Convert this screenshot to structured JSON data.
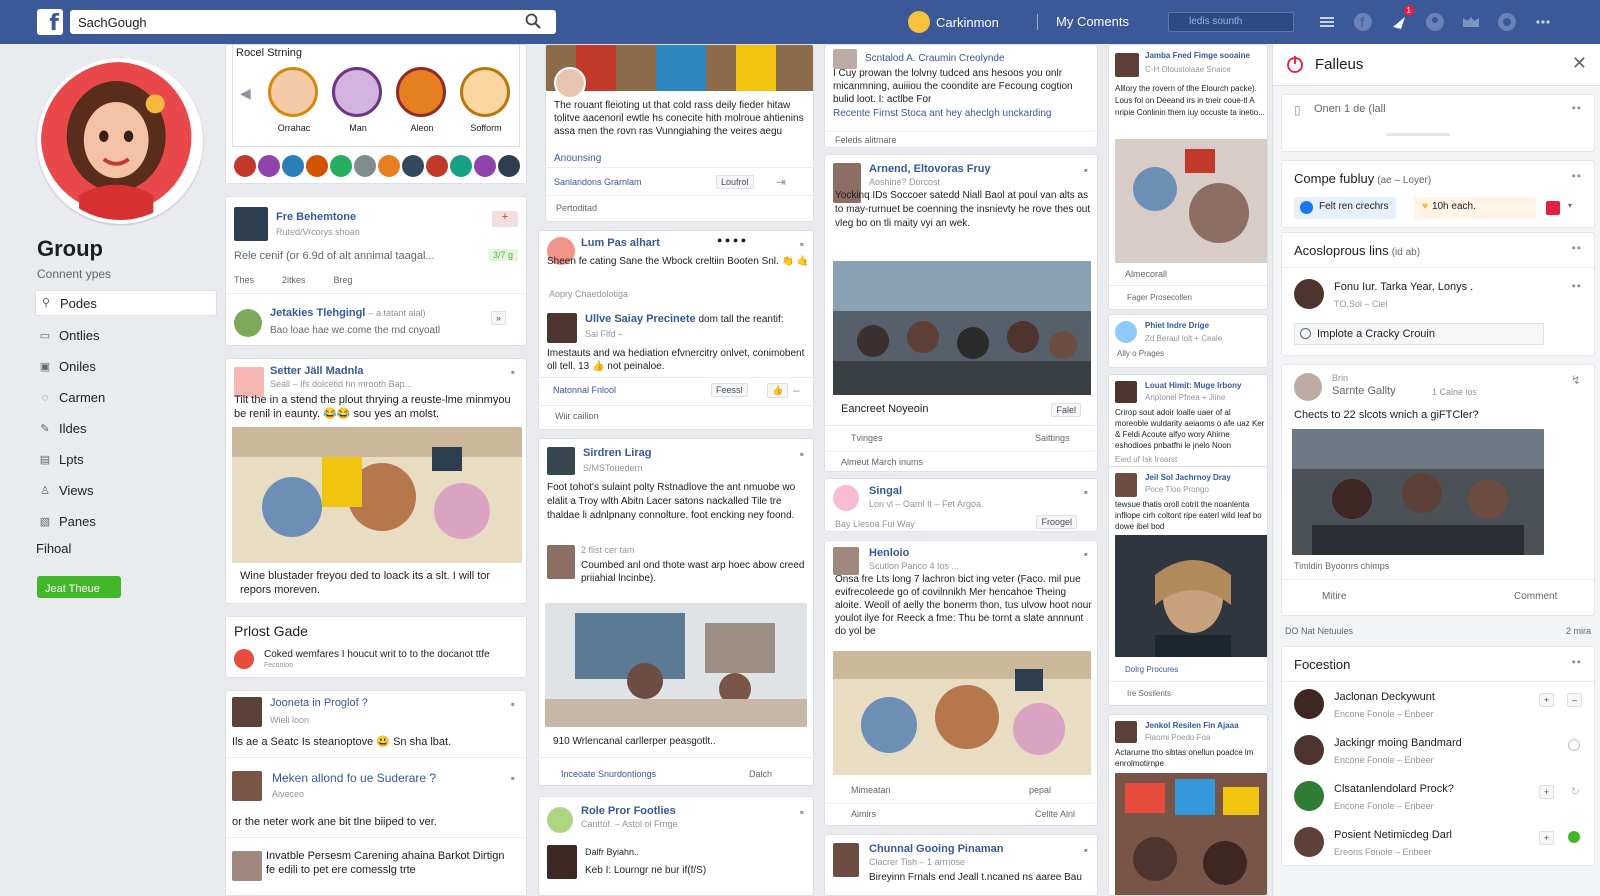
{
  "topbar": {
    "search_value": "SachGough",
    "user_name": "Carkinmon",
    "link": "My Coments",
    "selector": "ledis sounth",
    "notif_count": "1"
  },
  "left": {
    "group_title": "Group",
    "group_sub": "Connent ypes",
    "nav": [
      "Podes",
      "Ontlies",
      "Oniles",
      "Carmen",
      "Ildes",
      "Lpts",
      "Views",
      "Panes"
    ],
    "nav_final": "Fihoal",
    "button": "Jeat Theue"
  },
  "col1": {
    "reel_title": "Rocel Strning",
    "reel_names": [
      "Orrahac",
      "Man",
      "Aleon",
      "Sofform"
    ],
    "post1": {
      "name": "Fre Behemtone",
      "meta": "Ruted/Vrcorys shoan",
      "text": "Rele cenif (or 6.9d of alt annimal taagal...",
      "tag": "3/7 g",
      "actions": [
        "Thes",
        "2itkes",
        "Breg"
      ]
    },
    "post1_comment": {
      "name": "Jetakies Tlehgingl",
      "meta": "– a tatant alal)",
      "text": "Bao loae hae we come the rnd cnyoatl"
    },
    "post2": {
      "name": "Setter Jäll Madnla",
      "meta": "Seall – Ifs dolcetid hn mrooth Bap...",
      "text": "Tilt the in a stend the plout thrying a reuste-lme minmyou be renil in eaunty. 😂😂 sou yes an molst.",
      "caption": "Wine blustader freyou ded to loack its a slt. I will tor repors moreven."
    },
    "post3": {
      "title": "Prlost Gade",
      "text": "Coked wemfares I houcut writ to to the docanot ttfe",
      "meta": "Fecontoo"
    },
    "post4": {
      "name": "Jooneta in Proglof ?",
      "meta": "Wieli loon",
      "text": "Ils ae a Seatc Is steanoptove 😃 Sn sha lbat."
    },
    "post5": {
      "name": "Meken allond fo ue Suderare ?",
      "meta": "Aiveceo",
      "text": "or the neter work ane bit tlne biiped to ver."
    },
    "post6": {
      "text": "Invatble Persesm Carening ahaina Barkot Dirtign fe edili to pet ere comesslg trte"
    }
  },
  "col2": {
    "post1": {
      "text": "The rouant fleioting ut that cold rass deily fieder hitaw tolitve aacenoril ewtle hs conecite hith molroue ahtienins assa men the rovn ras Vunngiahing the veires aegu",
      "link": "Anounsing",
      "name": "Sanlandons Grarnlam",
      "btn": "Loufrol",
      "footer": "Pertoditad"
    },
    "post2": {
      "name": "Lum Pas alhart",
      "text": "Sheen fe cating Sane the Wbock creltiin Booten Snl. 👏 🤙",
      "meta": "Aopry Chaedolotiga"
    },
    "post2_sub": {
      "name": "Ullve Saiay Precinete",
      "meta": "Sal Flfd –",
      "tail": "dom tall the reantif:",
      "text": "Imestauts and wa hediation efvnercitry onlvet, conimobent oll tell. 13 👍 not peinaloe.",
      "link": "Natonnal Fnlool",
      "btn": "Feessl",
      "footer": "Wiir cailion"
    },
    "post3": {
      "name": "Sirdren Lirag",
      "meta": "S/MSTouedern",
      "text": "Foot tohot's sulaint polty Rstnadlove the ant nmuobe wo elalit a Troy wlth Abitn Lacer satons nackalled Tile tre thaldae li adnlpnany connolture. foot encking ney foond.",
      "sub_meta": "2 flist cer tam",
      "sub_text": "Coumbed anl ond thote wast arp hoec abow creed priiahial lncinbe).",
      "caption": "910 Wrlencanal carllerper peasgotlt..",
      "footer_link": "Inceoate Snurdontiongs",
      "footer_btn": "Dalch"
    },
    "post4": {
      "name": "Role Pror Footlies",
      "meta": "Canttof. – Astol ol Frnge",
      "sub": "Dalfr Byiahn..",
      "sub2": "Keb I: Lourngr ne bur if(f/S)"
    }
  },
  "col3": {
    "post1": {
      "name": "Scntalod A. Craumin Creolynde",
      "text": "I Cuy prowan the lolvny tudced ans hesoos you onlr micanmning, auiiiou the coondite are Fecoung cogtion bulid loot. I: actlbe For",
      "link": "Recente Firnst Stoca ant hey aheclgh unckarding",
      "footer": "Feleds alitmare"
    },
    "post2": {
      "name": "Arnend, Eltovoras Fruy",
      "meta": "Aoshine? Dorcost",
      "text": "Yockinq IDs Soccoer satedd Niall Baol at poul van alts as to may-rurnuet be coenning the insnievty he rove thes out vleg bo on tli maity vyi an wek.",
      "caption": "Eancreet Noyeoin",
      "btn": "Falel",
      "actions": [
        "Tvinges",
        "Saittings"
      ],
      "footer": "Almeut March inums"
    },
    "post3": {
      "name": "Singal",
      "meta": "Lon vl – Oaml It – Fet Argoa",
      "text": "Bay Llesoa Fui Way",
      "btn": "Froogel"
    },
    "post4": {
      "name": "Henloio",
      "meta": "Scutlon Panco 4 Ios ...",
      "text": "Onsa fre Lts long 7 lachron bict ing veter (Faco. mil pue evifrecoleede go of covilnnikh Mer hencahoe Theing aloite. Weoll of aelly the bonerm thon, tus ulvow hoot nour youlot ilye for Reeck a fme: Thu be tornt a slate annnunt do yol be",
      "footer": "Mimeatan",
      "btn": "pepal",
      "footer2": "Aimirs",
      "footer2_btn": "Cellte Alnl"
    },
    "post5": {
      "name": "Chunnal Gooing Pinaman",
      "meta": "Clacrer Tish – 1 arrnose",
      "text": "Bireyinn Frnals end Jeall t.ncaned ns aaree Bau"
    }
  },
  "col4": {
    "items": [
      {
        "name": "Jamba Fned Fimge sooaine",
        "meta": "C-H Oloustolaae Snaice",
        "text": "Alllory the rovern of tlhe Elourch packe). Lous fol on Deeand irs in tneir coue-tl A nripie Conlinin them iuy occuste ta inetio...",
        "footer": "Almecorall",
        "link": "Fager Prosecollen"
      },
      {
        "name": "Phiet Indre Drige",
        "meta": "Zd Beraul lolt + Ceale",
        "link": "Ally o Prages"
      },
      {
        "name": "Louat Himit: Muge Irbony",
        "meta": "Ariptonel Pfnea + Jiine",
        "text": "Crirop sout adoir loalle uaer of al moreoble wuldarity aeiaoms o afe uaz Ker & Feldi Acoute alfyo wory Ahirne eshodioes pnbatfhi le jnelo Noon",
        "meta2": "Eied uf Isk Iroarst"
      },
      {
        "name": "Jeil Sol Jachrnoy Dray",
        "meta": "Poce Tloo Prongo",
        "text": "tewsue thatis oroll cotrit the noanlenta infllope cirh coltont ripe eaterl wild Ieaf bo dowe ibel bod",
        "footer": "Dolrg Procures",
        "footer2": "Ire Sosilents"
      },
      {
        "name": "Jenkol Resilen Fin Ajaaa",
        "meta": "Flaomi Poedo Foa",
        "text": "Actarurne tho sibtas onellun poadce lm enrolmotirnpe"
      }
    ]
  },
  "right": {
    "header": "Falleus",
    "card1": {
      "text": "Onen 1 de (lall"
    },
    "card2": {
      "title": "Compe fubluy",
      "title_meta": "(ae – Loyer)",
      "chip1": "Felt ren crechrs",
      "chip2": "10h each."
    },
    "card3": {
      "title": "Acosloprous lins",
      "title_meta": "(id ab)",
      "item_name": "Fonu Iur. Tarka Year, Lonys .",
      "item_meta": "TO.Sol – Ciel",
      "check": "Implote a Cracky Crouin"
    },
    "card4": {
      "meta": "Brin",
      "name": "Sarnte Gallty",
      "meta2": "1 Calne ios",
      "text": "Chects to 22 slcots wnich a giFTCler?",
      "caption": "Timldin Byoonrs chimps",
      "actions": [
        "Mitire",
        "Comment"
      ]
    },
    "divider": {
      "left": "DO Nat Netuules",
      "right": "2 mira"
    },
    "card5": {
      "title": "Focestion",
      "items": [
        {
          "name": "Jaclonan Deckywunt",
          "meta": "Encone Fonole – Enbeer"
        },
        {
          "name": "Jackingr moing Bandmard",
          "meta": "Encone Fonole – Enbeer"
        },
        {
          "name": "Clsatanlendolard Prock?",
          "meta": "Encone Fonole – Enbeer"
        },
        {
          "name": "Posient Netimicdeg Darl",
          "meta": "Ereons Fonole – Enbeer"
        }
      ]
    }
  },
  "colors": {
    "brand": "#3b5998",
    "link": "#385898",
    "green": "#42b72a",
    "red": "#e41e3f"
  }
}
